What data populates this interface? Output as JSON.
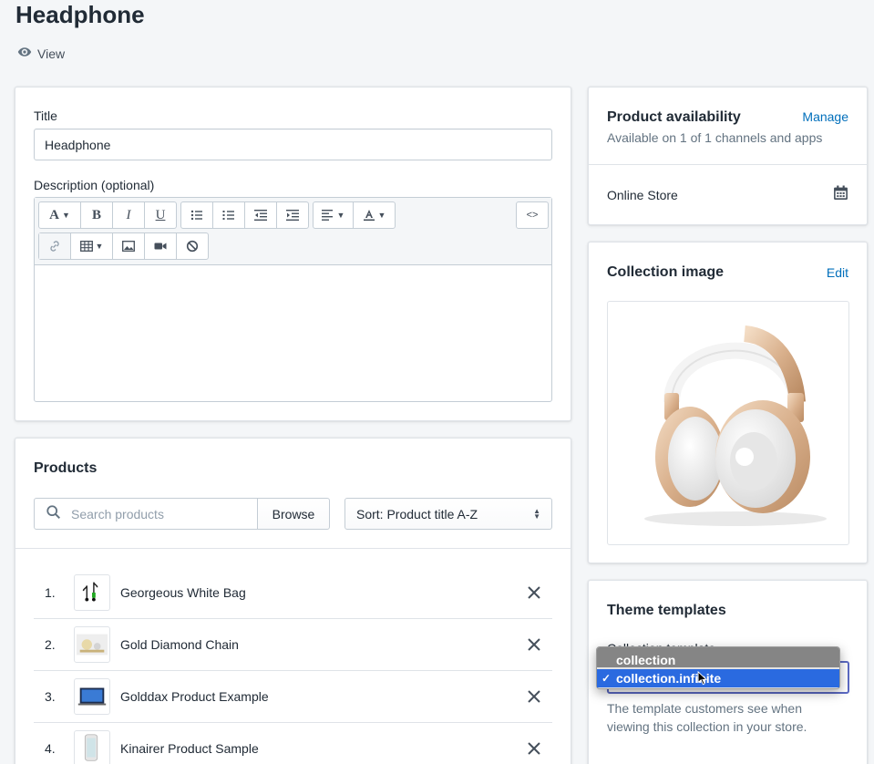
{
  "page": {
    "title": "Headphone",
    "view_label": "View"
  },
  "details": {
    "title_label": "Title",
    "title_value": "Headphone",
    "description_label": "Description (optional)",
    "toolbar": {
      "font_icon": "A",
      "bold": "B",
      "italic": "I",
      "underline": "U",
      "html_toggle": "<>"
    }
  },
  "products": {
    "heading": "Products",
    "search_placeholder": "Search products",
    "browse_label": "Browse",
    "sort_label": "Sort: Product title A-Z",
    "items": [
      {
        "num": "1.",
        "name": "Georgeous White Bag"
      },
      {
        "num": "2.",
        "name": "Gold Diamond Chain"
      },
      {
        "num": "3.",
        "name": "Golddax Product Example"
      },
      {
        "num": "4.",
        "name": "Kinairer Product Sample"
      }
    ]
  },
  "availability": {
    "heading": "Product availability",
    "manage_label": "Manage",
    "subtitle": "Available on 1 of 1 channels and apps",
    "channel": "Online Store"
  },
  "collection_image": {
    "heading": "Collection image",
    "edit_label": "Edit"
  },
  "theme": {
    "heading": "Theme templates",
    "template_label": "Collection template",
    "help_text": "The template customers see when viewing this collection in your store.",
    "options": [
      "collection",
      "collection.infinite"
    ],
    "selected": "collection.infinite",
    "check": "✓"
  },
  "colors": {
    "accent": "#006fbb",
    "select_highlight": "#2a6ae0",
    "focus_border": "#5c6ac4"
  }
}
